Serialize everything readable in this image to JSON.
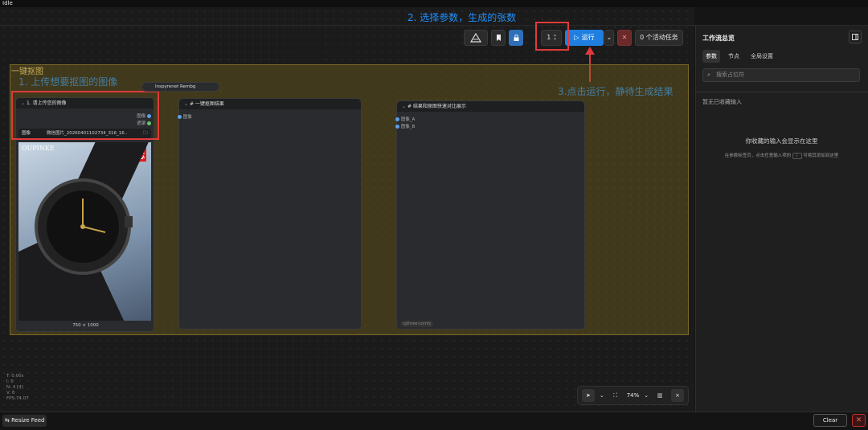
{
  "window": {
    "title": "Idle"
  },
  "annotations": {
    "step2": "2. 选择参数，生成的张数",
    "step1": "1. 上传想要抠图的图像",
    "step3": "3.点击运行，静待生成结果"
  },
  "toolbar": {
    "run_label": "运行",
    "tasks_label": "0 个活动任务",
    "count_value": "1"
  },
  "group": {
    "title": "一键抠图"
  },
  "nodes": {
    "upload": {
      "title": "1. 请上传您的图像",
      "out_image": "图像",
      "out_mask": "遮罩",
      "field_label": "图像",
      "filename": "微信图片_20260401102734_316_16...",
      "size_label": "750 × 1000",
      "badge_line1": "进口",
      "badge_line2": "机芯",
      "brand": "OUPINKE"
    },
    "rembg": {
      "title": "Inspyrenet Rembg"
    },
    "result": {
      "title": "# 一键抠图结果",
      "port": "图像"
    },
    "compare": {
      "title": "# 结果和原图快速对比展示",
      "port_a": "图像_A",
      "port_b": "图像_B",
      "footer": "rgthree-comfy"
    }
  },
  "right_panel": {
    "title": "工作流总览",
    "tabs": [
      "参数",
      "节点",
      "全局设置"
    ],
    "search_placeholder": "搜索占位符",
    "no_fav": "暂无已收藏输入",
    "empty_title": "你收藏的输入会显示在这里",
    "empty_hint_before": "在参数标签页，点击任意输入项的",
    "empty_hint_after": "可将其添加到这里"
  },
  "zoom": {
    "level": "74%"
  },
  "stats": [
    "T: 0.00s",
    "I: 0",
    "N: 4 [4]",
    "V: 8",
    "FPS:74.07"
  ],
  "bottom": {
    "resize_label": "Resize Feed",
    "clear_label": "Clear"
  }
}
